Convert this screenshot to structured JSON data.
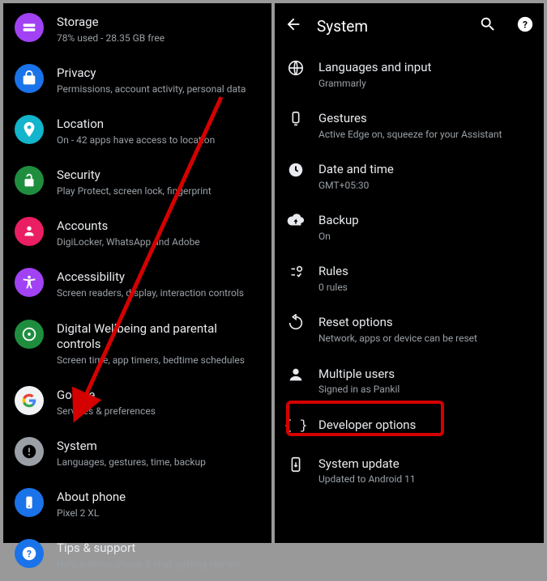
{
  "colors": {
    "storage": "#a142f4",
    "privacy": "#1a73e8",
    "location": "#12b5cb",
    "security": "#1e8e3e",
    "accounts": "#e91e63",
    "accessibility": "#a142f4",
    "wellbeing": "#1e8e3e",
    "google": "#f1f3f4",
    "system": "#9aa0a6",
    "about": "#1a73e8",
    "tips": "#1a73e8",
    "grey": "#e8eaed"
  },
  "left": [
    {
      "id": "storage",
      "title": "Storage",
      "sub": "78% used - 28.35 GB free"
    },
    {
      "id": "privacy",
      "title": "Privacy",
      "sub": "Permissions, account activity, personal data"
    },
    {
      "id": "location",
      "title": "Location",
      "sub": "On - 42 apps have access to location"
    },
    {
      "id": "security",
      "title": "Security",
      "sub": "Play Protect, screen lock, fingerprint"
    },
    {
      "id": "accounts",
      "title": "Accounts",
      "sub": "DigiLocker, WhatsApp and Adobe"
    },
    {
      "id": "accessibility",
      "title": "Accessibility",
      "sub": "Screen readers, display, interaction controls"
    },
    {
      "id": "wellbeing",
      "title": "Digital Wellbeing and parental controls",
      "sub": "Screen time, app timers, bedtime schedules"
    },
    {
      "id": "google",
      "title": "Google",
      "sub": "Services & preferences"
    },
    {
      "id": "system",
      "title": "System",
      "sub": "Languages, gestures, time, backup"
    },
    {
      "id": "about",
      "title": "About phone",
      "sub": "Pixel 2 XL"
    },
    {
      "id": "tips",
      "title": "Tips & support",
      "sub": "Help articles, phone & chat, getting started"
    }
  ],
  "right": {
    "title": "System",
    "items": [
      {
        "id": "lang",
        "title": "Languages and input",
        "sub": "Grammarly"
      },
      {
        "id": "gestures",
        "title": "Gestures",
        "sub": "Active Edge on, squeeze for your Assistant"
      },
      {
        "id": "datetime",
        "title": "Date and time",
        "sub": "GMT+05:30"
      },
      {
        "id": "backup",
        "title": "Backup",
        "sub": "On"
      },
      {
        "id": "rules",
        "title": "Rules",
        "sub": "0 rules"
      },
      {
        "id": "reset",
        "title": "Reset options",
        "sub": "Network, apps or device can be reset"
      },
      {
        "id": "users",
        "title": "Multiple users",
        "sub": "Signed in as Pankil"
      },
      {
        "id": "dev",
        "title": "Developer options",
        "sub": ""
      },
      {
        "id": "update",
        "title": "System update",
        "sub": "Updated to Android 11"
      }
    ]
  }
}
